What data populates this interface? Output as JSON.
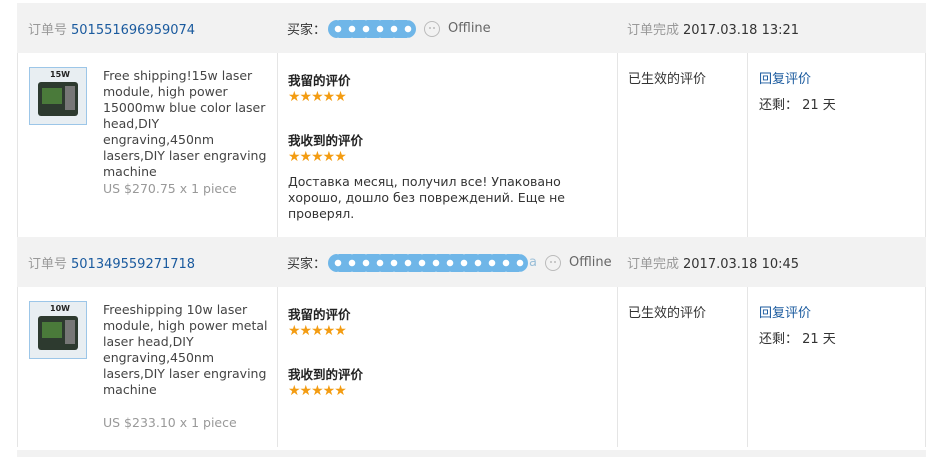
{
  "orders": [
    {
      "order_no_label": "订单号",
      "order_no": "501551696959074",
      "buyer_label": "买家：",
      "status": "Offline",
      "complete_label": "订单完成",
      "complete_date": "2017.03.18 13:21",
      "product": {
        "image_label": "15W",
        "title": "Free shipping!15w laser module, high power 15000mw blue color laser head,DIY engraving,450nm lasers,DIY laser engraving machine",
        "price": "US $270.75 x 1 piece"
      },
      "my_feedback_label": "我留的评价",
      "my_rating": "★★★★★",
      "received_feedback_label": "我收到的评价",
      "received_rating": "★★★★★",
      "received_text": "Доставка месяц, получил все! Упаковано хорошо, дошло без повреждений. Еще не проверял.",
      "effective": "已生效的评价",
      "reply": "回复评价",
      "remaining": "还剩： 21 天"
    },
    {
      "order_no_label": "订单号",
      "order_no": "501349559271718",
      "buyer_label": "买家：",
      "buyer_suffix": "a",
      "status": "Offline",
      "complete_label": "订单完成",
      "complete_date": "2017.03.18 10:45",
      "product": {
        "image_label": "10W",
        "title": "Freeshipping 10w laser module, high power metal laser head,DIY engraving,450nm lasers,DIY laser engraving machine",
        "price": "US $233.10 x 1 piece"
      },
      "my_feedback_label": "我留的评价",
      "my_rating": "★★★★★",
      "received_feedback_label": "我收到的评价",
      "received_rating": "★★★★★",
      "effective": "已生效的评价",
      "reply": "回复评价",
      "remaining": "还剩： 21 天"
    }
  ],
  "colors": {
    "link": "#1a5a9e",
    "star": "#f39c12",
    "header_bg": "#f2f2f2",
    "mask": "#6fb6e8"
  }
}
